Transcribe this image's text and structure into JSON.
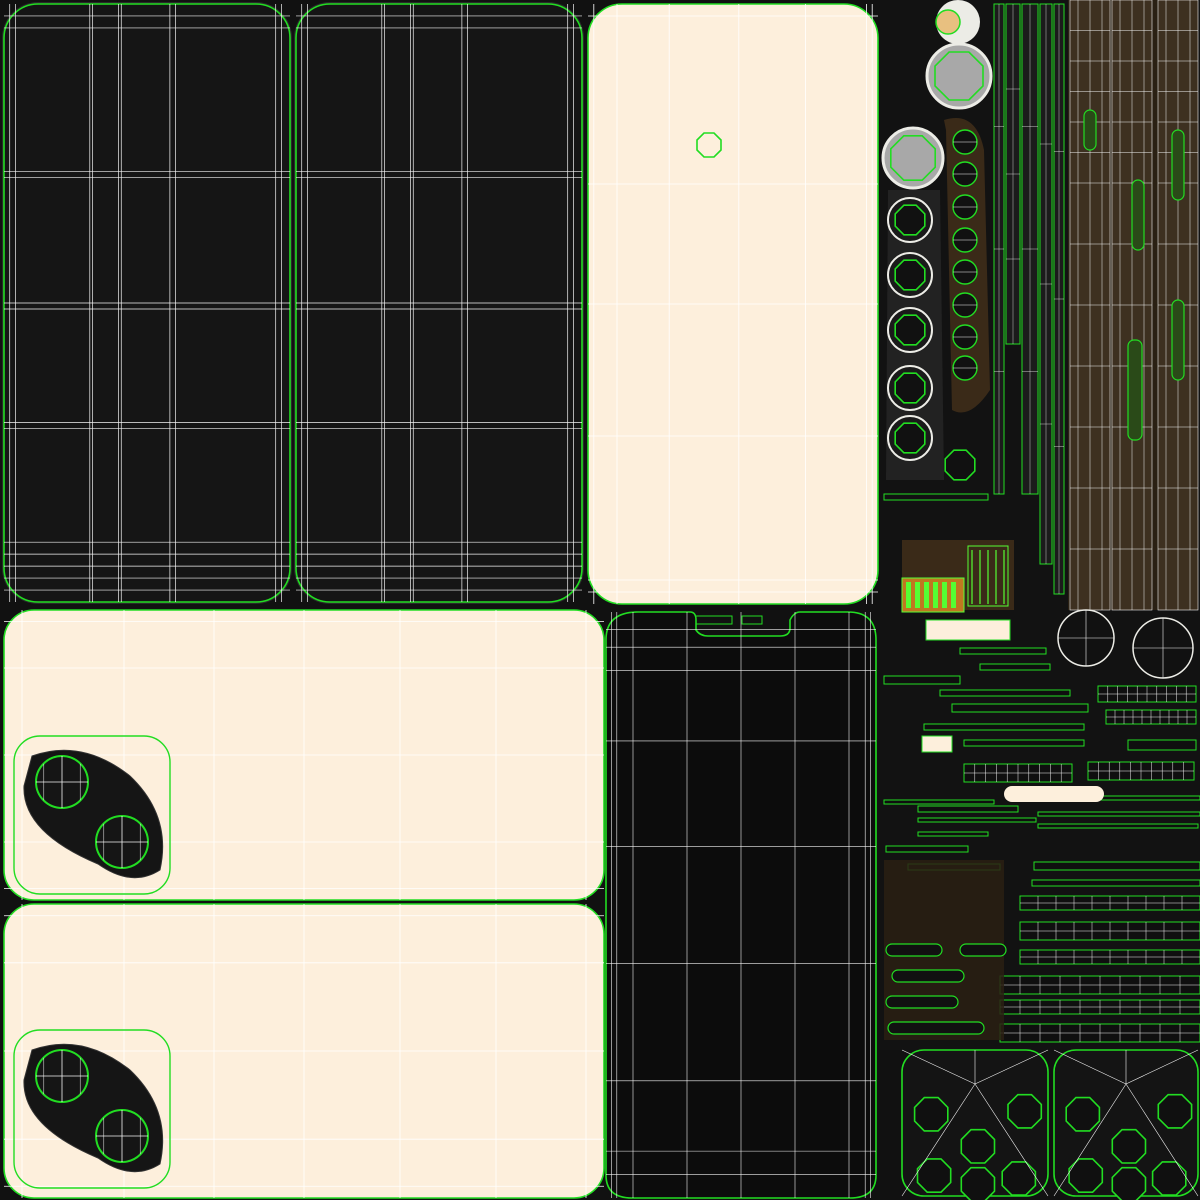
{
  "colors": {
    "background": "#111111",
    "shell_dark": "#151515",
    "cream": "#fdefdc",
    "seam_green": "#22dd22",
    "wire_white": "#f4f4f4",
    "brown": "#3a2a18",
    "dark_brown": "#2a2013",
    "metal_gray": "#a8a8a8",
    "orange_accent": "#c07820",
    "bright_green": "#55ff33",
    "off_white": "#ecece6"
  },
  "icons": {
    "camera_island": "camera-lens-cluster-icon",
    "speaker_grille": "speaker-grille-icon",
    "charging_port": "charging-port-icon"
  },
  "panels": {
    "black_back_tiles": 2,
    "cream_shell_tiles": 3,
    "speaker_discs": 8,
    "small_grille_discs": 8,
    "buttons_right_column": 6
  }
}
